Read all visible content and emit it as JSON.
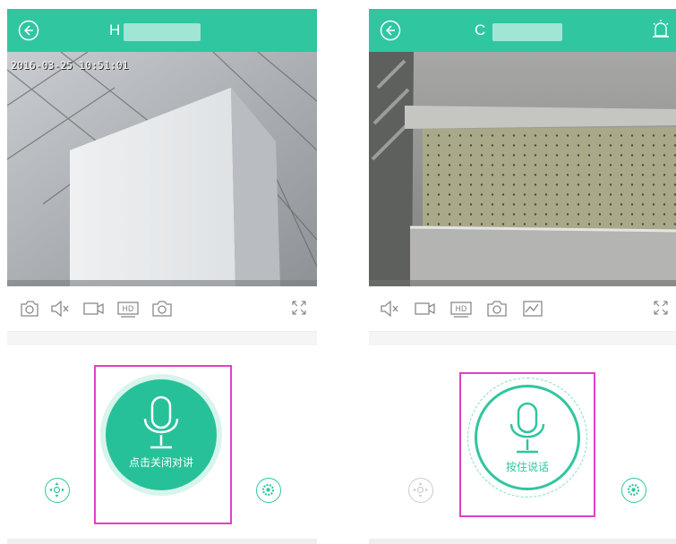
{
  "left_screen": {
    "title": "H",
    "timestamp": "2016-03-25 10:51:01",
    "toolbar": {
      "hd_label": "HD",
      "icons": [
        "rotate-camera-icon",
        "mute-icon",
        "record-icon",
        "hd-icon",
        "snapshot-icon",
        "fullscreen-icon"
      ]
    },
    "talk_button_label": "点击关闭对讲",
    "talk_state": "active"
  },
  "right_screen": {
    "title": "C",
    "toolbar": {
      "hd_label": "HD",
      "icons": [
        "mute-icon",
        "record-icon",
        "hd-icon",
        "snapshot-icon",
        "image-adjust-icon",
        "fullscreen-icon"
      ]
    },
    "talk_button_label": "按住说话",
    "talk_state": "idle"
  },
  "colors": {
    "accent": "#2fc6a0",
    "active_talk": "#27c199",
    "highlight": "#e040c8",
    "icon_gray": "#888888"
  }
}
